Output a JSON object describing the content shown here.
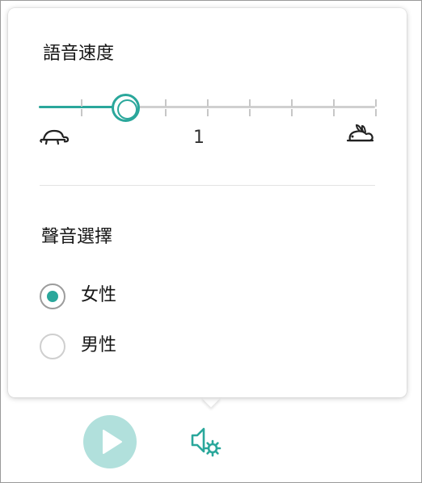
{
  "colors": {
    "accent": "#2aa79b",
    "play_bg": "#b1e0dc"
  },
  "speed": {
    "title": "語音速度",
    "value_label": "1",
    "value_fraction": 0.25,
    "tick_count": 8,
    "slow_icon": "turtle-icon",
    "fast_icon": "rabbit-icon"
  },
  "voice": {
    "title": "聲音選擇",
    "options": [
      {
        "label": "女性",
        "checked": true
      },
      {
        "label": "男性",
        "checked": false
      }
    ]
  },
  "toolbar": {
    "play_icon": "play-icon",
    "settings_icon": "voice-settings-icon"
  }
}
